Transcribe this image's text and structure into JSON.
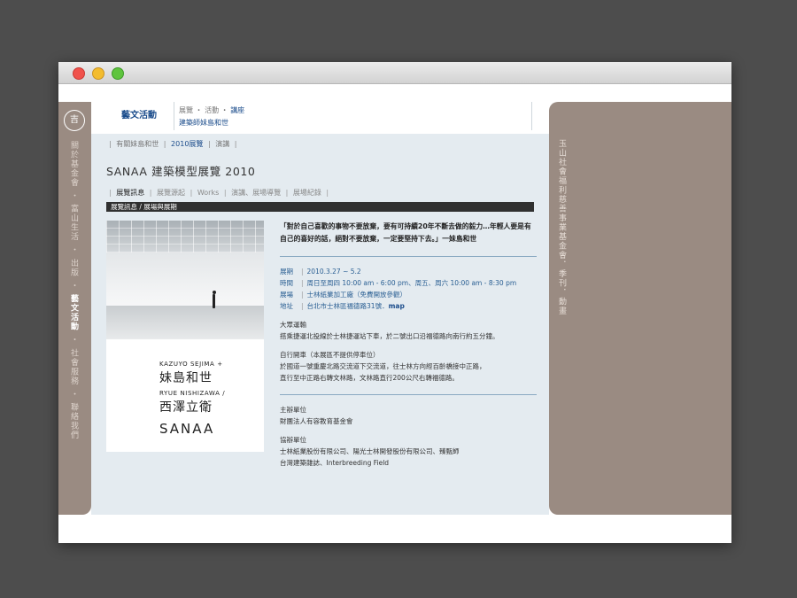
{
  "left_sidebar": {
    "logo_text": "吉",
    "nav": [
      {
        "label": "關於基金會"
      },
      {
        "label": "富山生活"
      },
      {
        "label": "出版"
      },
      {
        "label": "藝文活動",
        "active": true
      },
      {
        "label": "社會服務"
      },
      {
        "label": "聯絡我們"
      }
    ]
  },
  "right_sidebar": {
    "text": "玉山社會福利慈善事業基金會．季刊．動畫"
  },
  "top_nav": {
    "section": "藝文活動",
    "links": [
      "展覽",
      "活動",
      "講座"
    ],
    "current_item": "建築師妹島和世"
  },
  "subnav": {
    "items": [
      "有關妹島和世",
      "2010展覽",
      "演講"
    ],
    "selected_index": 1
  },
  "page": {
    "title": "SANAA 建築模型展覽 2010",
    "tabs": [
      "展覽訊息",
      "展覽源起",
      "Works",
      "演講、展場導覽",
      "展場紀錄"
    ],
    "selected_tab": 0,
    "section_bar": "展覽訊息 / 展場與展期"
  },
  "poster": {
    "line1": "KAZUYO SEJIMA +",
    "line2": "妹島和世",
    "line3": "RYUE NISHIZAWA /",
    "line4": "西澤立衛",
    "line5": "SANAA"
  },
  "info": {
    "quote_1": "「對於自己喜歡的事物不要放棄，要有可持續20年不斷去做的毅力…年輕人要是有",
    "quote_2": "自己的喜好的話，絕對不要放棄，一定要堅持下去。」一妹島和世",
    "details": [
      {
        "label": "展期",
        "value": "2010.3.27 ~ 5.2"
      },
      {
        "label": "時間",
        "value": "周日至周四 10:00 am - 6:00 pm、周五、周六 10:00 am - 8:30 pm"
      },
      {
        "label": "展場",
        "value": "士林紙業加工廠（免費開放參觀）"
      },
      {
        "label": "地址",
        "value": "台北市士林區福德路31號．",
        "link": "map"
      }
    ],
    "transport": {
      "heading": "大眾運輸",
      "line": "搭乘捷運北投線於士林捷運站下車，於二號出口沿福德路向南行約五分鐘。"
    },
    "driving": {
      "heading": "自行開車（本展區不提供停車位）",
      "line1": "於國道一號重慶北路交流道下交流道，往士林方向經百齡橋接中正路，",
      "line2": "直行至中正路右轉文林路，文林路直行200公尺右轉福德路。"
    },
    "organizer": {
      "heading": "主辦單位",
      "line": "財團法人有容教育基金會"
    },
    "co_organizer": {
      "heading": "協辦單位",
      "line1": "士林紙業股份有限公司、陽光士林開發股份有限公司、臻甄師",
      "line2": "台灣建築雜誌、Interbreeding Field"
    }
  }
}
